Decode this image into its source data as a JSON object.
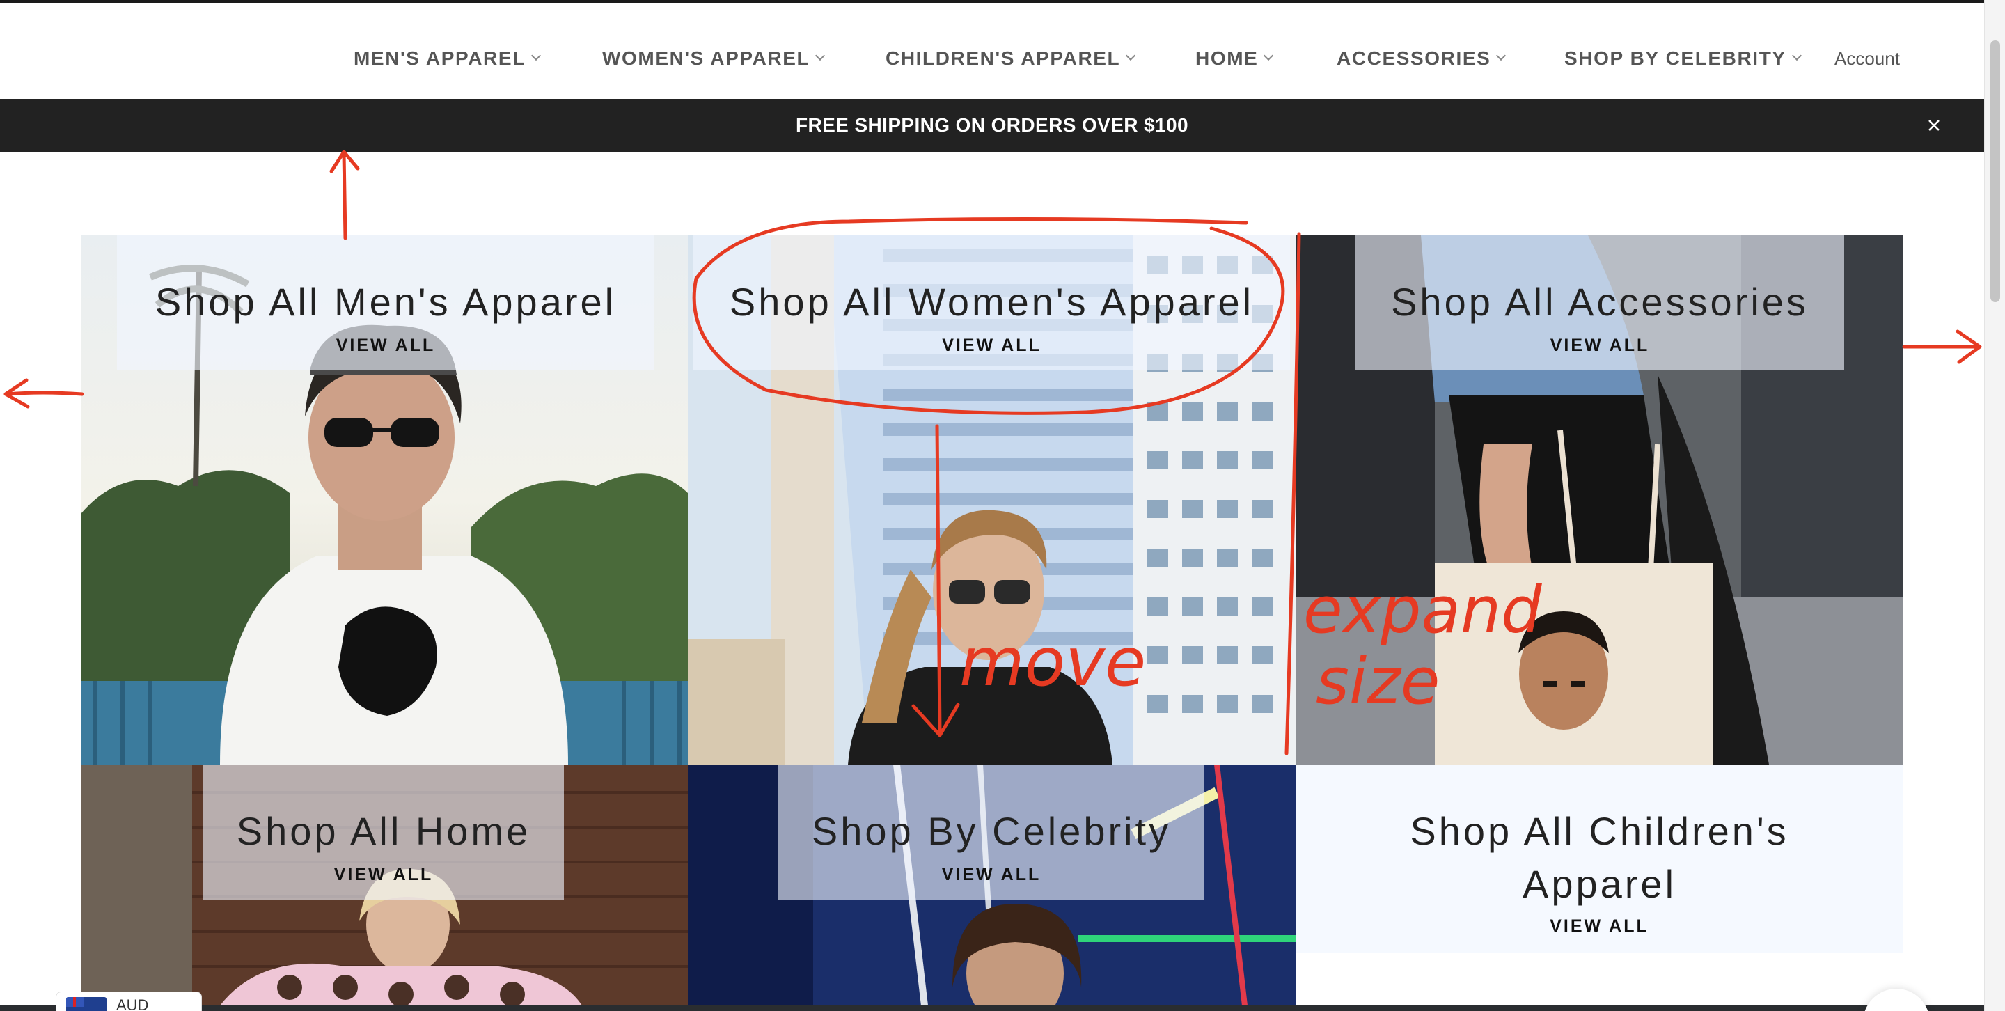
{
  "nav": {
    "items": [
      {
        "label": "MEN'S APPAREL"
      },
      {
        "label": "WOMEN'S APPAREL"
      },
      {
        "label": "CHILDREN'S APPAREL"
      },
      {
        "label": "HOME"
      },
      {
        "label": "ACCESSORIES"
      },
      {
        "label": "SHOP BY CELEBRITY"
      }
    ],
    "account_label": "Account"
  },
  "banner": {
    "text": "FREE SHIPPING ON ORDERS OVER $100",
    "close_icon": "close-icon"
  },
  "collections": [
    {
      "title": "Shop All Men's Apparel",
      "link": "VIEW ALL"
    },
    {
      "title": "Shop All Women's Apparel",
      "link": "VIEW ALL"
    },
    {
      "title": "Shop All Accessories",
      "link": "VIEW ALL"
    },
    {
      "title": "Shop All Home",
      "link": "VIEW ALL"
    },
    {
      "title": "Shop By Celebrity",
      "link": "VIEW ALL"
    },
    {
      "title": "Shop All Children's Apparel",
      "link": "VIEW ALL"
    }
  ],
  "annotations": {
    "move": "move",
    "expand": "expand",
    "size": "size"
  },
  "currency": {
    "code": "AUD",
    "flag_icon": "australia-flag-icon"
  },
  "colors": {
    "banner_bg": "#222222",
    "annotation": "#e63a22",
    "nav_text": "#555555",
    "caption_bg": "#f0f6ff"
  }
}
